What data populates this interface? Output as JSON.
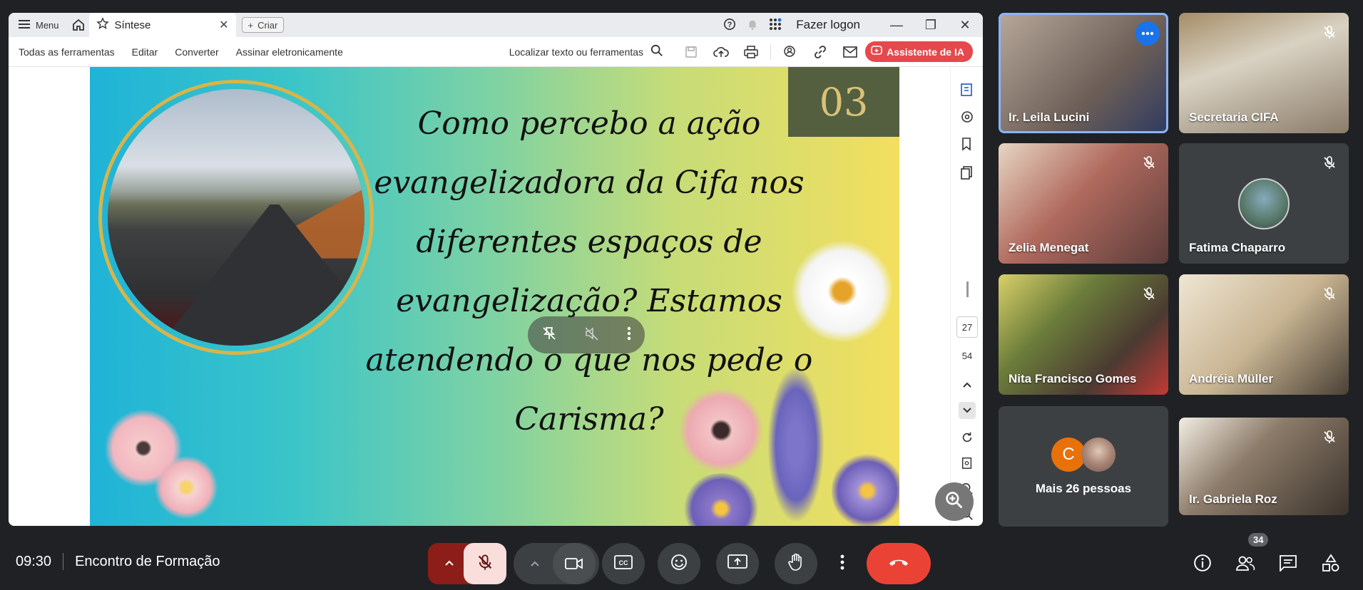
{
  "browser": {
    "menu_label": "Menu",
    "tab_title": "Síntese",
    "new_tab_label": "Criar",
    "signin_label": "Fazer logon"
  },
  "toolbar": {
    "all_tools": "Todas as ferramentas",
    "edit": "Editar",
    "convert": "Converter",
    "sign": "Assinar eletronicamente",
    "find_placeholder": "Localizar texto ou ferramentas",
    "ai_assistant": "Assistente de IA"
  },
  "document": {
    "slide_number": "03",
    "question": "Como percebo a ação evangelizadora da Cifa nos diferentes espaços de evangelização? Estamos atendendo o que nos pede o Carisma?",
    "current_page": "27",
    "total_pages": "54"
  },
  "participants": [
    {
      "name": "Ir. Leila Lucini",
      "active": true
    },
    {
      "name": "Secretaria CIFA",
      "active": false
    },
    {
      "name": "Zelia Menegat",
      "active": false
    },
    {
      "name": "Fatima Chaparro",
      "active": false
    },
    {
      "name": "Nita Francisco Gomes",
      "active": false
    },
    {
      "name": "Andréia Müller",
      "active": false
    },
    {
      "name": "Mais 26 pessoas",
      "initial": "C",
      "active": false
    },
    {
      "name": "Ir. Gabriela Roz",
      "active": false
    }
  ],
  "meeting": {
    "time": "09:30",
    "title": "Encontro de Formação",
    "participant_count": "34"
  },
  "colors": {
    "accent_blue": "#8ab4f8",
    "end_call_red": "#ea4335",
    "mic_off_bg": "#f9dedc",
    "ai_button": "#e5484d"
  }
}
